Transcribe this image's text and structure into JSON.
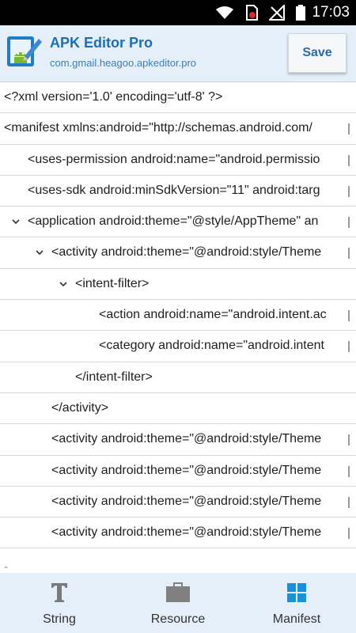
{
  "status_bar": {
    "time": "17:03"
  },
  "app": {
    "title": "APK Editor Pro",
    "package": "com.gmail.heagoo.apkeditor.pro",
    "save_label": "Save"
  },
  "xml_lines": [
    "<?xml version='1.0' encoding='utf-8' ?>",
    "<manifest xmlns:android=\"http://schemas.android.com/",
    "<uses-permission android:name=\"android.permissio",
    "<uses-sdk android:minSdkVersion=\"11\" android:targ",
    "<application android:theme=\"@style/AppTheme\" an",
    "<activity android:theme=\"@android:style/Theme",
    "<intent-filter>",
    "<action android:name=\"android.intent.ac",
    "<category android:name=\"android.intent",
    "</intent-filter>",
    "</activity>",
    "<activity android:theme=\"@android:style/Theme",
    "<activity android:theme=\"@android:style/Theme",
    "<activity android:theme=\"@android:style/Theme",
    "<activity android:theme=\"@android:style/Theme"
  ],
  "trailing_mark": "-",
  "bottom_nav": {
    "string_label": "String",
    "resource_label": "Resource",
    "manifest_label": "Manifest"
  }
}
